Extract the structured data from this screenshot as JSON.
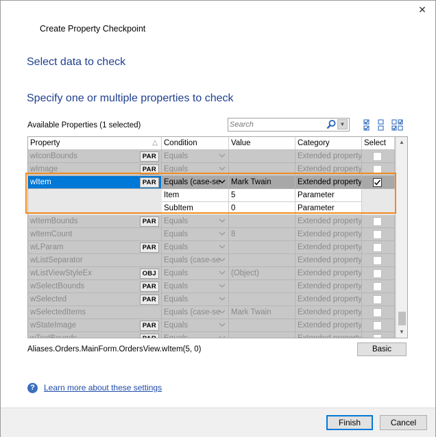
{
  "dialog": {
    "title": "Create Property Checkpoint",
    "close_glyph": "✕",
    "heading_primary": "Select data to check",
    "heading_secondary": "Specify one or multiple properties to check",
    "available_label": "Available Properties (1 selected)"
  },
  "search": {
    "placeholder": "Search",
    "value": ""
  },
  "toolbar_icons": [
    "check-all-icon",
    "uncheck-all-icon",
    "toggle-check-icon"
  ],
  "table": {
    "headers": {
      "property": "Property",
      "sort_glyph": "△",
      "condition": "Condition",
      "value": "Value",
      "category": "Category",
      "select": "Select"
    },
    "rows": [
      {
        "property": "wIconBounds",
        "badge": "PAR",
        "condition": "Equals",
        "value": "",
        "category": "Extended property",
        "checked": false
      },
      {
        "property": "wImage",
        "badge": "PAR",
        "condition": "Equals",
        "value": "",
        "category": "Extended property",
        "checked": false
      },
      {
        "property": "wItem",
        "badge": "PAR",
        "condition": "Equals (case-se",
        "value": "Mark Twain",
        "category": "Extended property",
        "checked": true,
        "selected": true
      },
      {
        "property": "wItemBounds",
        "badge": "PAR",
        "condition": "Equals",
        "value": "",
        "category": "Extended property",
        "checked": false
      },
      {
        "property": "wItemCount",
        "badge": "",
        "condition": "Equals",
        "value": "8",
        "category": "Extended property",
        "checked": false
      },
      {
        "property": "wLParam",
        "badge": "PAR",
        "condition": "Equals",
        "value": "",
        "category": "Extended property",
        "checked": false
      },
      {
        "property": "wListSeparator",
        "badge": "",
        "condition": "Equals (case-se",
        "value": "",
        "category": "Extended property",
        "checked": false
      },
      {
        "property": "wListViewStyleEx",
        "badge": "OBJ",
        "condition": "Equals",
        "value": "(Object)",
        "category": "Extended property",
        "checked": false
      },
      {
        "property": "wSelectBounds",
        "badge": "PAR",
        "condition": "Equals",
        "value": "",
        "category": "Extended property",
        "checked": false
      },
      {
        "property": "wSelected",
        "badge": "PAR",
        "condition": "Equals",
        "value": "",
        "category": "Extended property",
        "checked": false
      },
      {
        "property": "wSelectedItems",
        "badge": "",
        "condition": "Equals (case-se",
        "value": "Mark Twain",
        "category": "Extended property",
        "checked": false
      },
      {
        "property": "wStateImage",
        "badge": "PAR",
        "condition": "Equals",
        "value": "",
        "category": "Extended property",
        "checked": false
      },
      {
        "property": "wTextBounds",
        "badge": "PAR",
        "condition": "Equals",
        "value": "",
        "category": "Extended property",
        "checked": false
      }
    ],
    "parameters": [
      {
        "name": "Item",
        "value": "5",
        "category": "Parameter"
      },
      {
        "name": "SubItem",
        "value": "0",
        "category": "Parameter"
      }
    ]
  },
  "object_path": "Aliases.Orders.MainForm.OrdersView.wItem(5, 0)",
  "basic_button": "Basic",
  "help_link": "Learn more about these settings",
  "footer": {
    "finish": "Finish",
    "cancel": "Cancel"
  },
  "colors": {
    "heading": "#1f3f8f",
    "selection": "#0078d7",
    "highlight_frame": "#f08a1c",
    "link": "#1f4aa8"
  }
}
